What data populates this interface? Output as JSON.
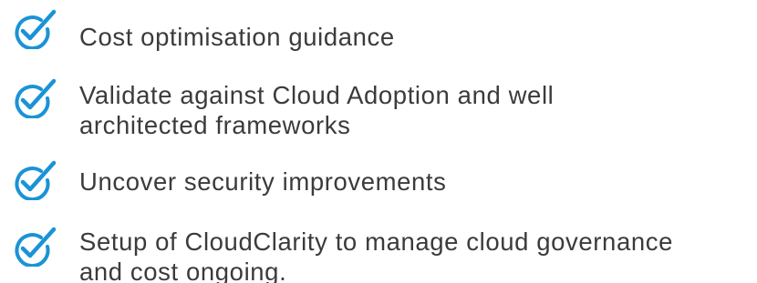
{
  "accent_color": "#1a93d6",
  "text_color": "#3b3b3b",
  "items": [
    {
      "icon": "check-circle-icon",
      "lines": [
        "Cost optimisation guidance"
      ]
    },
    {
      "icon": "check-circle-icon",
      "lines": [
        "Validate against Cloud Adoption and well",
        "architected frameworks"
      ]
    },
    {
      "icon": "check-circle-icon",
      "lines": [
        "Uncover security improvements"
      ]
    },
    {
      "icon": "check-circle-icon",
      "lines": [
        "Setup of CloudClarity to manage cloud governance",
        "and cost ongoing."
      ]
    }
  ]
}
